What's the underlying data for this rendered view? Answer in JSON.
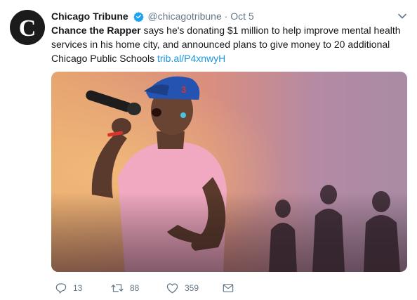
{
  "tweet": {
    "author_name": "Chicago Tribune",
    "handle": "@chicagotribune",
    "separator": "·",
    "date": "Oct 5",
    "text_bold": "Chance the Rapper",
    "text_body": " says he's donating $1 million to help improve mental health services in his home city, and announced plans to give money to 20 additional Chicago Public Schools ",
    "link": "trib.al/P4xnwyH",
    "avatar_icon": "chicago-tribune-logo-icon",
    "verified_icon": "verified-badge-icon",
    "media_alt": "photo-of-singer-with-microphone"
  },
  "actions": {
    "reply_count": "13",
    "retweet_count": "88",
    "like_count": "359"
  },
  "colors": {
    "link": "#1b95e0",
    "verified": "#1da1f2",
    "muted": "#657786"
  }
}
